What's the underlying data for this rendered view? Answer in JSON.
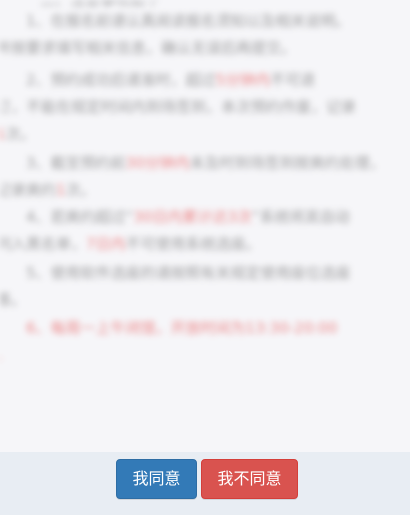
{
  "content": {
    "line_0": "二、注意事项如下",
    "line_1": "1、在报名前请认真阅读报名须知以及相关说明。",
    "line_2": "并按要求填写相关信息，确认无误后再提交。",
    "line_3a": "2、预约成功后请准时，超过",
    "line_3_red": "5分钟内",
    "line_3b": "不可退",
    "line_4": "订，不能在规定时间内到场签到，本次预约作废，记录",
    "line_5a": "",
    "line_5_red": "1",
    "line_5b": "次。",
    "line_6a": "3、截至预约前",
    "line_6_red": "30分钟内",
    "line_6b": "未及时到场签到按爽约处理，",
    "line_7a": "记录爽约",
    "line_7_red": "1",
    "line_7b": "次。",
    "line_8a": "4、若爽约超过“",
    "line_8_red": "30日内累计达3次",
    "line_8b": "”系统将其自动",
    "line_9a": "列入黑名单，",
    "line_9_red": "7日内",
    "line_9b": "不可使用系统选座。",
    "line_10": "5、使用软件选座的请按照有关规定使用座位选座",
    "line_11": "等。",
    "line_12_red": "6、每周一上午闭馆，开放时间为13:30-20:00",
    "line_13_red": "。"
  },
  "footer": {
    "agree_label": "我同意",
    "disagree_label": "我不同意",
    "agree_color": "#337ab7",
    "disagree_color": "#d9534f"
  }
}
